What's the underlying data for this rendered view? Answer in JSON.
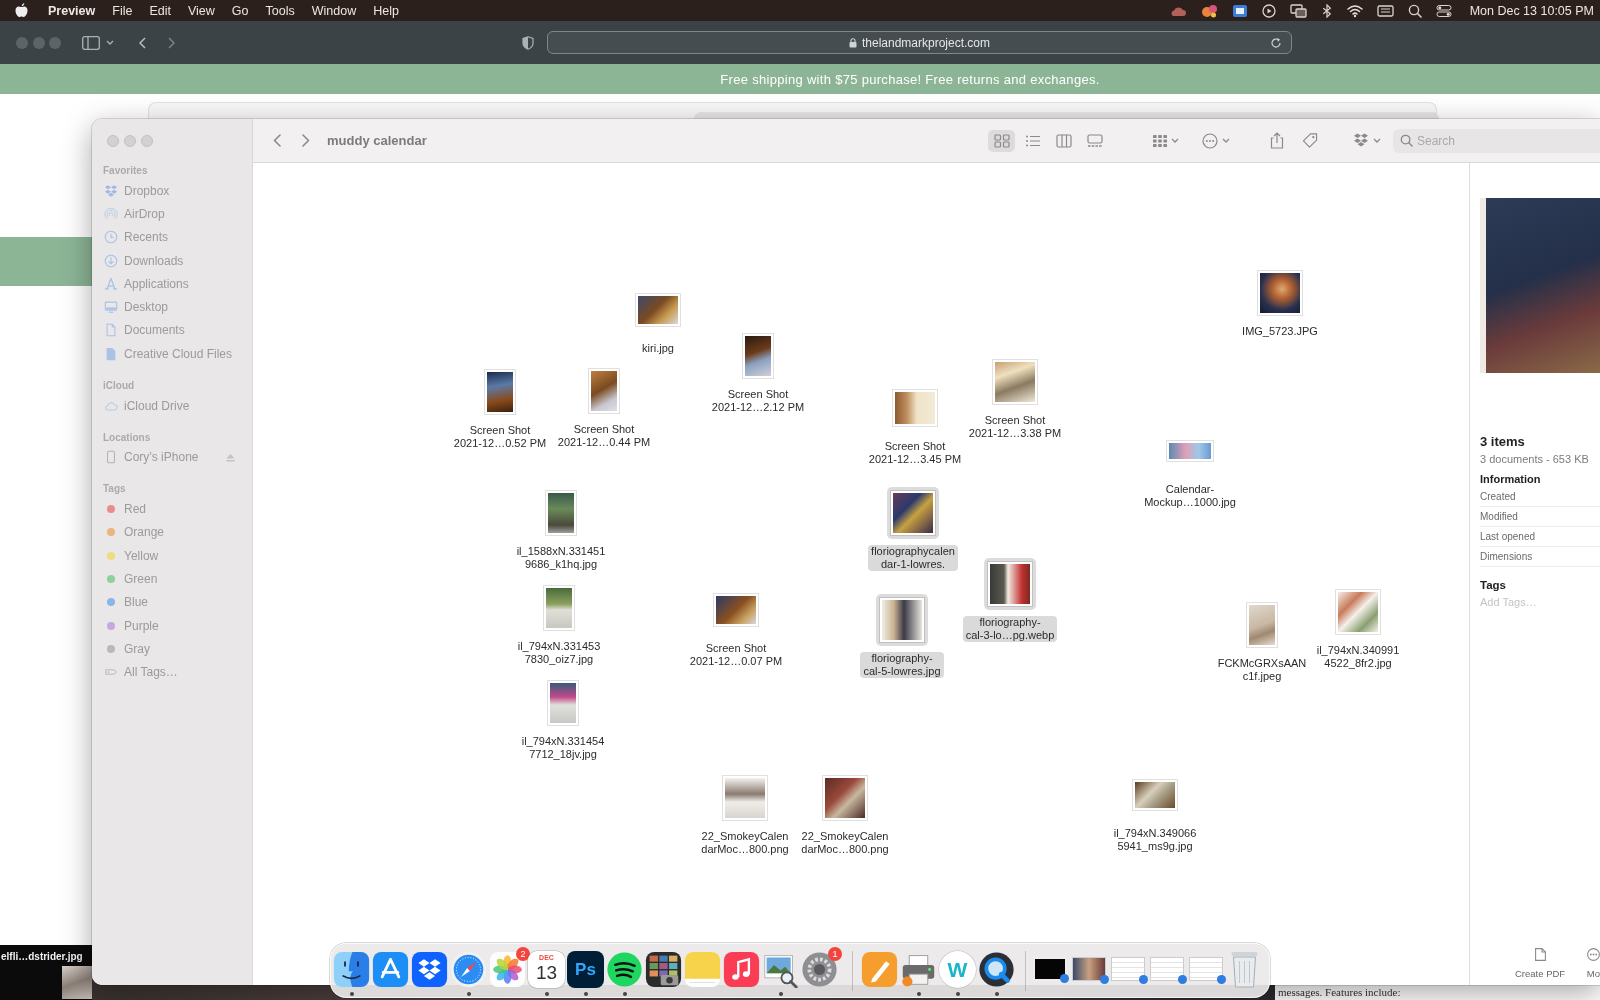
{
  "menu_bar": {
    "app_name": "Preview",
    "menus": [
      "File",
      "Edit",
      "View",
      "Go",
      "Tools",
      "Window",
      "Help"
    ],
    "clock": "Mon Dec 13 10:05 PM"
  },
  "browser": {
    "url": "thelandmarkproject.com",
    "banner": "Free shipping with $75 purchase! Free returns and exchanges.",
    "page_text": "messages. Features include:"
  },
  "desktop": {
    "file_label": "elfli…dstrider.jpg"
  },
  "finder": {
    "title": "muddy calendar",
    "view_modes": [
      {
        "kind": "icons",
        "selected": true
      },
      {
        "kind": "list",
        "selected": false
      },
      {
        "kind": "columns",
        "selected": false
      },
      {
        "kind": "gallery",
        "selected": false
      }
    ],
    "search": {
      "placeholder": "Search"
    },
    "sidebar": [
      {
        "heading": "Favorites",
        "items": [
          {
            "label": "Dropbox",
            "kind": "dropbox"
          },
          {
            "label": "AirDrop",
            "kind": "airdrop"
          },
          {
            "label": "Recents",
            "kind": "clock"
          },
          {
            "label": "Downloads",
            "kind": "download"
          },
          {
            "label": "Applications",
            "kind": "apps"
          },
          {
            "label": "Desktop",
            "kind": "desktop"
          },
          {
            "label": "Documents",
            "kind": "document"
          },
          {
            "label": "Creative Cloud Files",
            "kind": "file"
          }
        ]
      },
      {
        "heading": "iCloud",
        "items": [
          {
            "label": "iCloud Drive",
            "kind": "cloud"
          }
        ]
      },
      {
        "heading": "Locations",
        "items": [
          {
            "label": "Cory’s iPhone",
            "kind": "phone",
            "ejectable": true
          }
        ]
      },
      {
        "heading": "Tags",
        "items": [
          {
            "label": "Red",
            "kind": "tag",
            "color": "#e88c8c"
          },
          {
            "label": "Orange",
            "kind": "tag",
            "color": "#ebb57e"
          },
          {
            "label": "Yellow",
            "kind": "tag",
            "color": "#eedc7e"
          },
          {
            "label": "Green",
            "kind": "tag",
            "color": "#8fd09c"
          },
          {
            "label": "Blue",
            "kind": "tag",
            "color": "#8cb5ea"
          },
          {
            "label": "Purple",
            "kind": "tag",
            "color": "#c8a6df"
          },
          {
            "label": "Gray",
            "kind": "tag",
            "color": "#b9b9b9"
          },
          {
            "label": "All Tags…",
            "kind": "all-tags"
          }
        ]
      }
    ],
    "files": [
      {
        "label_lines": [
          "kiri.jpg"
        ],
        "selected": false
      },
      {
        "label_lines": [
          "IMG_5723.JPG"
        ],
        "selected": false
      },
      {
        "label_lines": [
          "Screen Shot",
          "2021-12…0.52 PM"
        ],
        "selected": false
      },
      {
        "label_lines": [
          "Screen Shot",
          "2021-12…0.44 PM"
        ],
        "selected": false
      },
      {
        "label_lines": [
          "Screen Shot",
          "2021-12…2.12 PM"
        ],
        "selected": false
      },
      {
        "label_lines": [
          "Screen Shot",
          "2021-12…3.45 PM"
        ],
        "selected": false
      },
      {
        "label_lines": [
          "Screen Shot",
          "2021-12…3.38 PM"
        ],
        "selected": false
      },
      {
        "label_lines": [
          "Calendar-",
          "Mockup…1000.jpg"
        ],
        "selected": false
      },
      {
        "label_lines": [
          "il_1588xN.331451",
          "9686_k1hq.jpg"
        ],
        "selected": false
      },
      {
        "label_lines": [
          "floriographycalen",
          "dar-1-lowres."
        ],
        "selected": true
      },
      {
        "label_lines": [
          "il_794xN.331453",
          "7830_oiz7.jpg"
        ],
        "selected": false
      },
      {
        "label_lines": [
          "Screen Shot",
          "2021-12…0.07 PM"
        ],
        "selected": false
      },
      {
        "label_lines": [
          "floriography-",
          "cal-5-lowres.jpg"
        ],
        "selected": true
      },
      {
        "label_lines": [
          "floriography-",
          "cal-3-lo…pg.webp"
        ],
        "selected": true
      },
      {
        "label_lines": [
          "FCKMcGRXsAAN",
          "c1f.jpeg"
        ],
        "selected": false
      },
      {
        "label_lines": [
          "il_794xN.340991",
          "4522_8fr2.jpg"
        ],
        "selected": false
      },
      {
        "label_lines": [
          "il_794xN.331454",
          "7712_18jv.jpg"
        ],
        "selected": false
      },
      {
        "label_lines": [
          "22_SmokeyCalen",
          "darMoc…800.png"
        ],
        "selected": false
      },
      {
        "label_lines": [
          "22_SmokeyCalen",
          "darMoc…800.png"
        ],
        "selected": false
      },
      {
        "label_lines": [
          "il_794xN.349066",
          "5941_ms9g.jpg"
        ],
        "selected": false
      }
    ],
    "preview": {
      "summary": "3 items",
      "detail": "3 documents - 653 KB",
      "info_heading": "Information",
      "info_rows": [
        "Created",
        "Modified",
        "Last opened",
        "Dimensions"
      ],
      "tags_heading": "Tags",
      "tags_placeholder": "Add Tags…",
      "actions": [
        {
          "kind": "pdf",
          "label": "Create PDF"
        },
        {
          "kind": "more",
          "label": "Mo"
        }
      ]
    }
  },
  "dock": {
    "apps": [
      {
        "kind": "finder",
        "running": true
      },
      {
        "kind": "app-store",
        "running": false
      },
      {
        "kind": "dropbox",
        "running": false
      },
      {
        "kind": "safari",
        "running": true
      },
      {
        "kind": "photos",
        "running": false,
        "badge": "2"
      },
      {
        "kind": "calendar",
        "running": true,
        "month": "DEC",
        "day": "13"
      },
      {
        "kind": "photoshop",
        "running": true,
        "label": "Ps"
      },
      {
        "kind": "spotify",
        "running": true
      },
      {
        "kind": "photo-grid",
        "running": false
      },
      {
        "kind": "notes",
        "running": false
      },
      {
        "kind": "music",
        "running": false
      },
      {
        "kind": "preview",
        "running": true
      },
      {
        "kind": "settings",
        "running": false,
        "badge": "1"
      }
    ],
    "tools": [
      {
        "kind": "pen",
        "running": false
      },
      {
        "kind": "printer",
        "running": true
      },
      {
        "kind": "letter",
        "running": true,
        "label": "W"
      },
      {
        "kind": "lens",
        "running": true
      }
    ],
    "windows": [
      {
        "kind": "dark"
      },
      {
        "kind": "collage"
      },
      {
        "kind": "document"
      },
      {
        "kind": "document"
      },
      {
        "kind": "document"
      }
    ]
  }
}
